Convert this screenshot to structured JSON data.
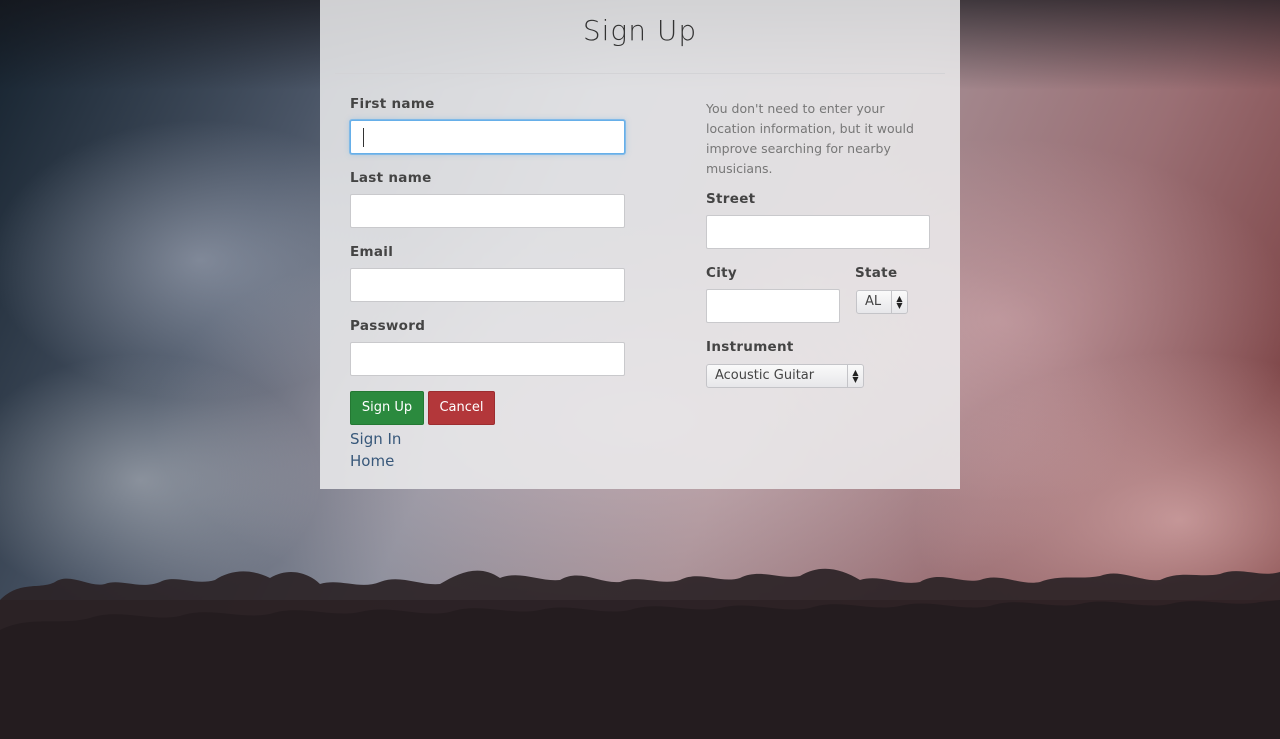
{
  "page": {
    "title": "Sign Up"
  },
  "form": {
    "first_name": {
      "label": "First name",
      "value": ""
    },
    "last_name": {
      "label": "Last name",
      "value": ""
    },
    "email": {
      "label": "Email",
      "value": ""
    },
    "password": {
      "label": "Password",
      "value": ""
    },
    "location_help": "You don't need to enter your location information, but it would improve searching for nearby musicians.",
    "street": {
      "label": "Street",
      "value": ""
    },
    "city": {
      "label": "City",
      "value": ""
    },
    "state": {
      "label": "State",
      "selected": "AL"
    },
    "instrument": {
      "label": "Instrument",
      "selected": "Acoustic Guitar"
    }
  },
  "buttons": {
    "sign_up": "Sign Up",
    "cancel": "Cancel"
  },
  "links": {
    "sign_in": "Sign In",
    "home": "Home"
  },
  "colors": {
    "primary_button": "#2b8a3e",
    "cancel_button": "#b3373a",
    "link": "#38587a",
    "focus_ring": "#66afe9"
  },
  "icons": {
    "select_arrows": "up-down-arrows-icon"
  }
}
